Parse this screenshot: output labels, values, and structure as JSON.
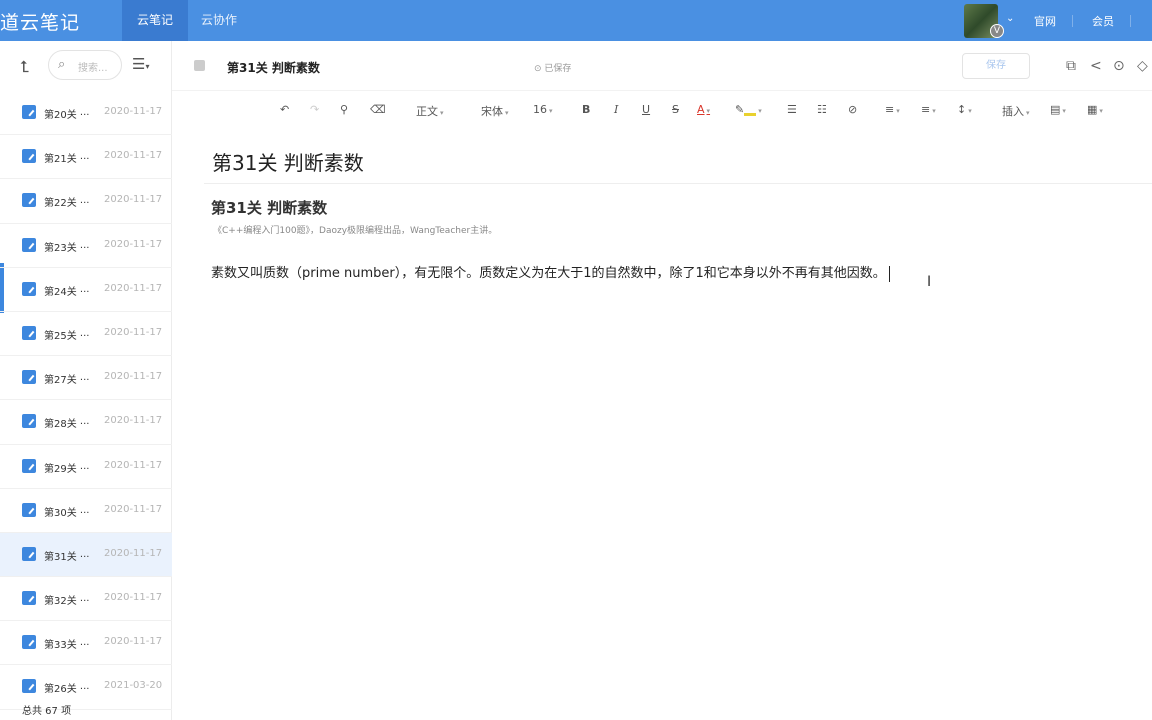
{
  "app": {
    "brand": "道云笔记",
    "tabs": [
      {
        "label": "云笔记",
        "active": true
      },
      {
        "label": "云协作",
        "active": false
      }
    ],
    "links": {
      "official": "官网",
      "member": "会员"
    },
    "avatar_badge": "V",
    "colors": {
      "topbar": "#4a90e2",
      "accent": "#3d87de",
      "selected_row": "#eaf2fd"
    }
  },
  "sidebar": {
    "search_placeholder": "搜索...",
    "icons": {
      "up": "up-arrow-icon",
      "search": "search-icon",
      "menu": "menu-icon"
    },
    "notes": [
      {
        "title": "第20关 ···",
        "date": "2020-11-17"
      },
      {
        "title": "第21关 ···",
        "date": "2020-11-17"
      },
      {
        "title": "第22关 ···",
        "date": "2020-11-17"
      },
      {
        "title": "第23关 ···",
        "date": "2020-11-17"
      },
      {
        "title": "第24关 ···",
        "date": "2020-11-17"
      },
      {
        "title": "第25关 ···",
        "date": "2020-11-17"
      },
      {
        "title": "第27关 ···",
        "date": "2020-11-17"
      },
      {
        "title": "第28关 ···",
        "date": "2020-11-17"
      },
      {
        "title": "第29关 ···",
        "date": "2020-11-17"
      },
      {
        "title": "第30关 ···",
        "date": "2020-11-17"
      },
      {
        "title": "第31关 ···",
        "date": "2020-11-17",
        "selected": true
      },
      {
        "title": "第32关 ···",
        "date": "2020-11-17"
      },
      {
        "title": "第33关 ···",
        "date": "2020-11-17"
      },
      {
        "title": "第26关 ···",
        "date": "2021-03-20"
      }
    ],
    "footer": "总共 67 项"
  },
  "header": {
    "doc_title": "第31关 判断素数",
    "saved_status": "已保存",
    "save_label": "保存",
    "icons": [
      "copy-icon",
      "share-icon",
      "play-icon",
      "tag-icon"
    ]
  },
  "toolbar": {
    "paragraph_style": "正文",
    "font_family": "宋体",
    "font_size": "16",
    "bold": "B",
    "italic": "I",
    "underline": "U",
    "strike": "S",
    "font_color": "A",
    "insert": "插入"
  },
  "document": {
    "title": "第31关 判断素数",
    "heading": "第31关 判断素数",
    "subtitle": "《C++编程入门100题》，Daozy极限编程出品，WangTeacher主讲。",
    "paragraph": "素数又叫质数（prime number），有无限个。质数定义为在大于1的自然数中，除了1和它本身以外不再有其他因数。"
  }
}
